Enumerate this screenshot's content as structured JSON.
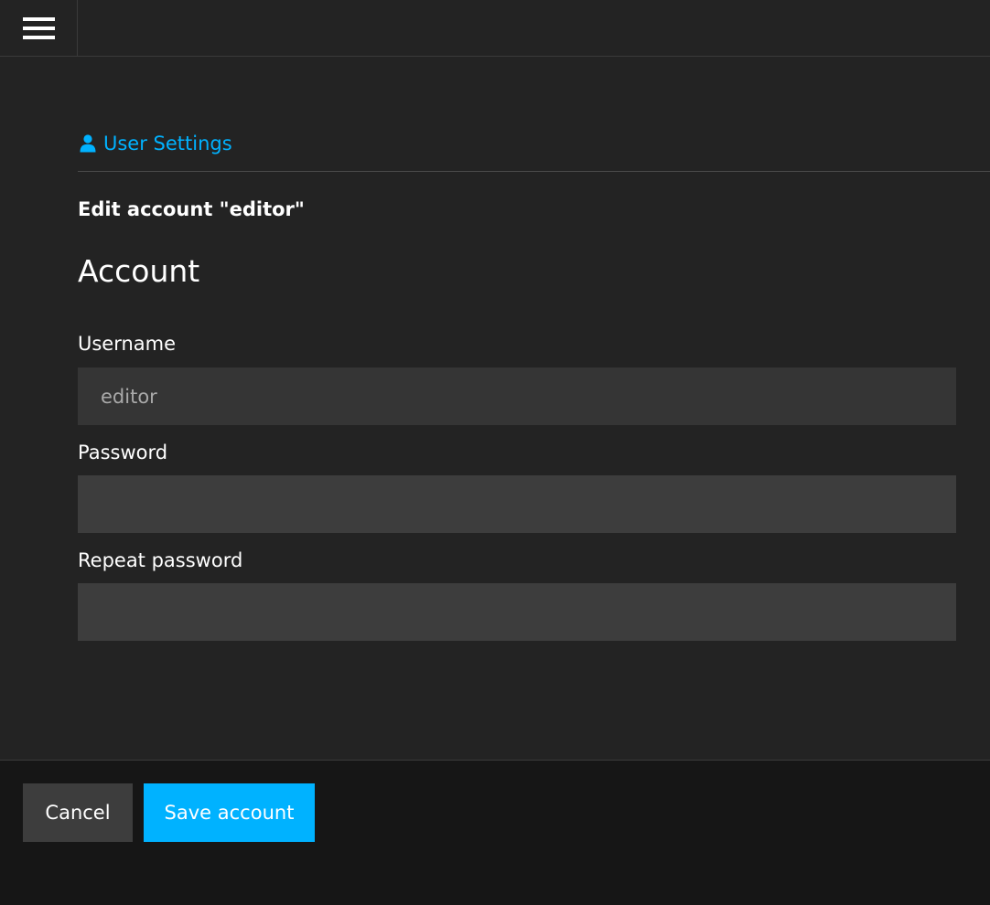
{
  "topbar": {
    "menu_icon": "hamburger-icon"
  },
  "section": {
    "icon": "user-icon",
    "label": "User Settings",
    "accent_color": "#00b2ff"
  },
  "page": {
    "edit_title": "Edit account \"editor\"",
    "form_heading": "Account"
  },
  "form": {
    "username": {
      "label": "Username",
      "value": "editor"
    },
    "password": {
      "label": "Password",
      "value": ""
    },
    "repeat_password": {
      "label": "Repeat password",
      "value": ""
    }
  },
  "footer": {
    "cancel_label": "Cancel",
    "save_label": "Save account"
  }
}
